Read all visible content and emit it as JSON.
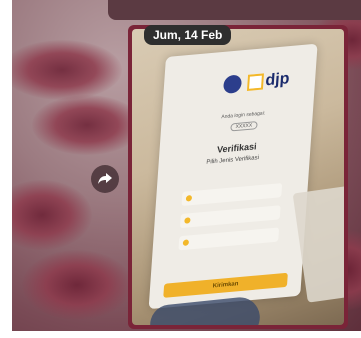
{
  "message": {
    "date_chip": "Jum, 14 Feb"
  },
  "phone_page": {
    "logo_text": "djp",
    "login_as_label": "Anda login sebagai:",
    "npwp_value": "XXXXX",
    "verify_title": "Verifikasi",
    "verify_subtitle": "Pilih Jenis Verifikasi",
    "submit_label": "Kirimkan"
  },
  "colors": {
    "bubble_border": "#7a2438",
    "date_chip_bg": "#2e2e2e",
    "accent_yellow": "#f0b12a"
  }
}
